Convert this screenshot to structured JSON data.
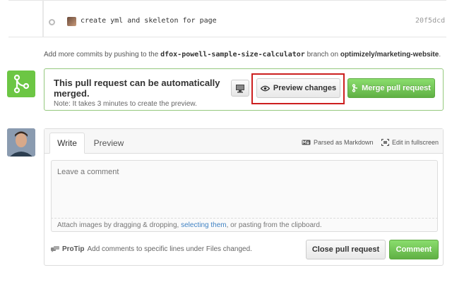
{
  "commit": {
    "message": "create yml and skeleton for page",
    "sha": "20f5dcd"
  },
  "push_note": {
    "prefix": "Add more commits by pushing to the",
    "branch": "dfox-powell-sample-size-calculator",
    "middle": "branch on",
    "repo": "optimizely/marketing-website",
    "suffix": "."
  },
  "merge": {
    "title": "This pull request can be automatically merged.",
    "note": "Note: It takes 3 minutes to create the preview.",
    "preview_label": "Preview changes",
    "merge_label": "Merge pull request",
    "icon": "git-merge-icon",
    "accent": "#6cc644"
  },
  "comment": {
    "tabs": [
      "Write",
      "Preview"
    ],
    "markdown_note": "Parsed as Markdown",
    "fullscreen_note": "Edit in fullscreen",
    "placeholder": "Leave a comment",
    "attach_prefix": "Attach images by dragging & dropping,",
    "attach_link": "selecting them",
    "attach_suffix": ", or pasting from the clipboard.",
    "protip_label": "ProTip",
    "protip_text": "Add comments to specific lines under Files changed.",
    "close_label": "Close pull request",
    "comment_label": "Comment"
  }
}
